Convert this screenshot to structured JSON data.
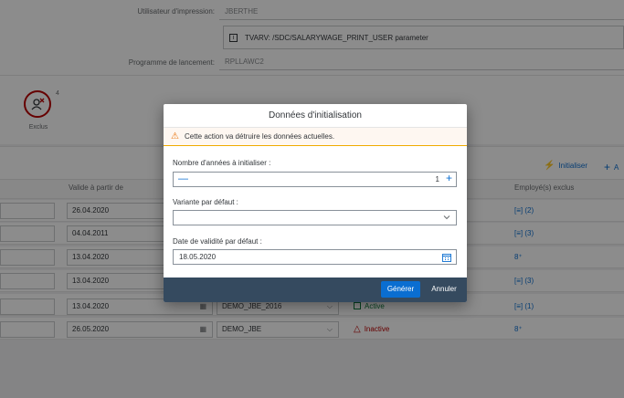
{
  "form": {
    "user_label": "Utilisateur d'impression:",
    "user_value": "JBERTHE",
    "tvarv_text": "TVARV: /SDC/SALARYWAGE_PRINT_USER parameter",
    "program_label": "Programme de lancement:",
    "program_value": "RPLLAWC2"
  },
  "kpi": {
    "count": "4",
    "label": "Exclus"
  },
  "toolbar": {
    "init_label": "Initialiser",
    "add_label": "A"
  },
  "table": {
    "col_valid_from": "Valide à partir de",
    "col_excluded": "Employé(s) exclus",
    "rows": [
      {
        "date": "26.04.2020",
        "excl": "(2)",
        "excl_type": "list"
      },
      {
        "date": "04.04.2011",
        "excl": "(3)",
        "excl_type": "list"
      },
      {
        "date": "13.04.2020",
        "excl": "",
        "excl_type": "add"
      },
      {
        "date": "13.04.2020",
        "excl": "(3)",
        "excl_type": "list"
      },
      {
        "date": "13.04.2020",
        "variant": "DEMO_JBE_2016",
        "status": "Active",
        "excl": "(1)",
        "excl_type": "list"
      },
      {
        "date": "26.05.2020",
        "variant": "DEMO_JBE",
        "status": "Inactive",
        "excl": "",
        "excl_type": "add"
      }
    ]
  },
  "dialog": {
    "title": "Données d'initialisation",
    "warning": "Cette action va détruire les données actuelles.",
    "years_label": "Nombre d'années à initialiser :",
    "years_value": "1",
    "variant_label": "Variante par défaut :",
    "variant_value": "",
    "date_label": "Date de validité par défaut :",
    "date_value": "18.05.2020",
    "generate_label": "Générer",
    "cancel_label": "Annuler"
  },
  "colors": {
    "accent": "#0a6ed1",
    "footer": "#354a5f",
    "warning": "#e9730c",
    "error": "#bb0000",
    "success": "#107e3e"
  }
}
